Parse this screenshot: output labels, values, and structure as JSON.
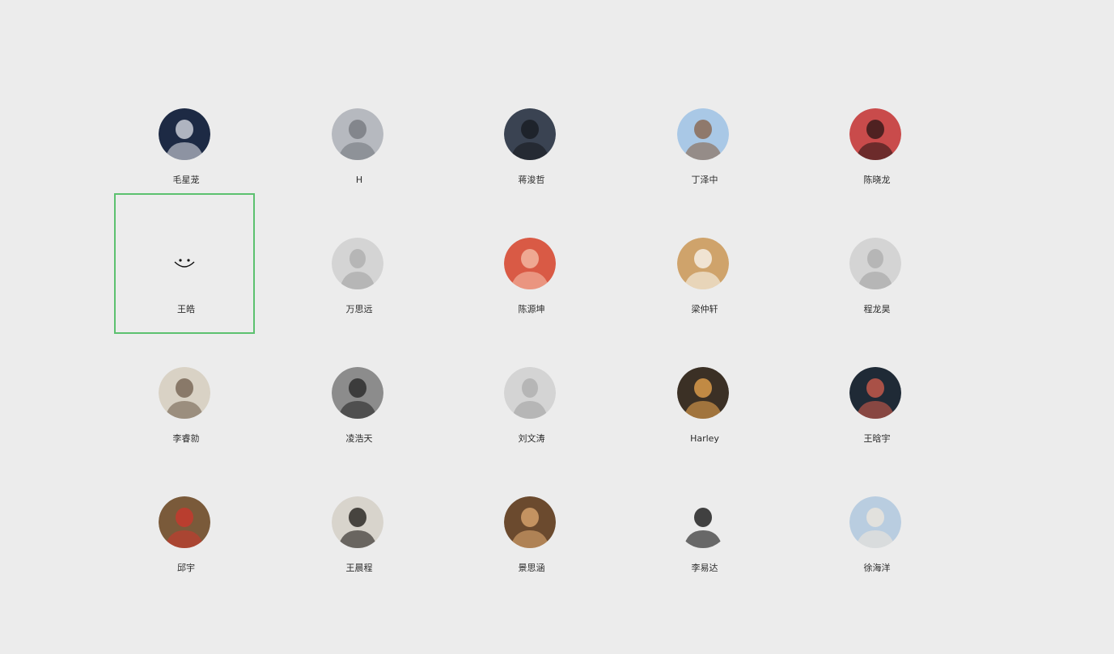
{
  "contacts": [
    {
      "name": "毛星茏",
      "avatar": "person-microphone-photo",
      "bg": "#1d2a44",
      "fg": "#c9ccd6",
      "selected": false
    },
    {
      "name": "H",
      "avatar": "person-cap-photo",
      "bg": "#b6b9bf",
      "fg": "#7a7d82",
      "selected": false
    },
    {
      "name": "蒋浚哲",
      "avatar": "silhouette-photo",
      "bg": "#3a4352",
      "fg": "#1a1d24",
      "selected": false
    },
    {
      "name": "丁泽中",
      "avatar": "cartoon-sky-photo",
      "bg": "#a9c8e6",
      "fg": "#8b6b56",
      "selected": false
    },
    {
      "name": "陈晓龙",
      "avatar": "person-stage-red-photo",
      "bg": "#c94b4b",
      "fg": "#3a1a1a",
      "selected": false
    },
    {
      "name": "王皓",
      "avatar": "smiley-face-icon",
      "bg": "#ececec",
      "fg": "#111111",
      "selected": true
    },
    {
      "name": "万思远",
      "avatar": "default-avatar-icon",
      "bg": "#d4d4d4",
      "fg": "#b6b6b6",
      "selected": false
    },
    {
      "name": "陈源坤",
      "avatar": "cartoon-red-face-photo",
      "bg": "#d95a45",
      "fg": "#f2b6a0",
      "selected": false
    },
    {
      "name": "梁仲轩",
      "avatar": "shiba-dog-photo",
      "bg": "#cfa36b",
      "fg": "#f6efe4",
      "selected": false
    },
    {
      "name": "程龙昊",
      "avatar": "default-avatar-icon",
      "bg": "#d4d4d4",
      "fg": "#b6b6b6",
      "selected": false
    },
    {
      "name": "李睿勍",
      "avatar": "leopard-pattern-photo",
      "bg": "#d9d2c5",
      "fg": "#7a6a58",
      "selected": false
    },
    {
      "name": "凌浩天",
      "avatar": "person-bw-photo",
      "bg": "#8c8c8c",
      "fg": "#2e2e2e",
      "selected": false
    },
    {
      "name": "刘文涛",
      "avatar": "default-avatar-icon",
      "bg": "#d4d4d4",
      "fg": "#b6b6b6",
      "selected": false
    },
    {
      "name": "Harley",
      "avatar": "orange-cat-photo",
      "bg": "#3b3025",
      "fg": "#d99a4a",
      "selected": false
    },
    {
      "name": "王晗宇",
      "avatar": "dark-sunset-photo",
      "bg": "#1f2a36",
      "fg": "#c2584a",
      "selected": false
    },
    {
      "name": "邱宇",
      "avatar": "opera-costume-photo",
      "bg": "#7a5a3a",
      "fg": "#c43a2e",
      "selected": false
    },
    {
      "name": "王晨程",
      "avatar": "cartoon-tiger-photo",
      "bg": "#d8d4cc",
      "fg": "#2e2a26",
      "selected": false
    },
    {
      "name": "景思涵",
      "avatar": "fluffy-dog-photo",
      "bg": "#6b4a2e",
      "fg": "#d4a06a",
      "selected": false
    },
    {
      "name": "李易达",
      "avatar": "anime-sketch-photo",
      "bg": "#ececec",
      "fg": "#222222",
      "selected": false
    },
    {
      "name": "徐海洋",
      "avatar": "snowy-trees-photo",
      "bg": "#b9cde0",
      "fg": "#e9e4dc",
      "selected": false
    }
  ],
  "accent_selected_border": "#5cc16f"
}
